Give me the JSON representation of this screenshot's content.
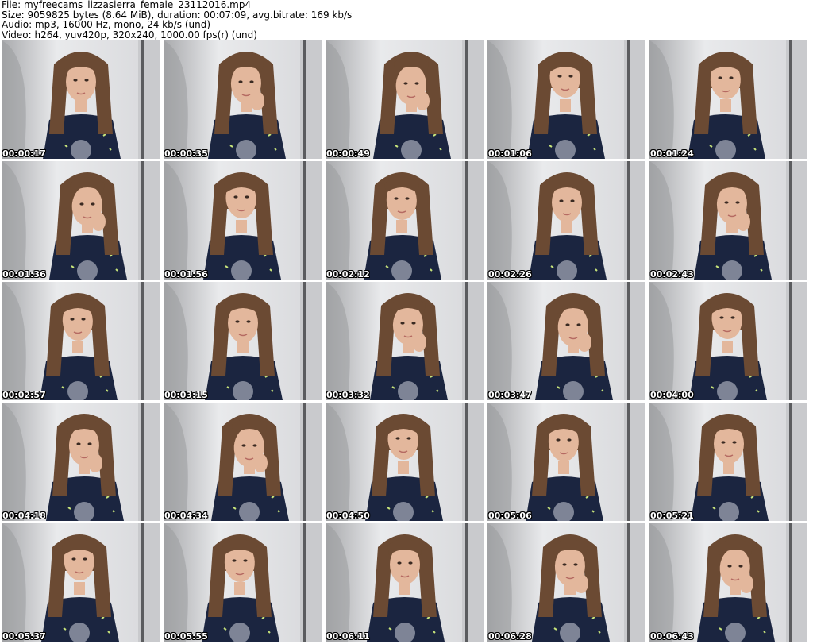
{
  "header": {
    "file": "File: myfreecams_lizzasierra_female_23112016.mp4",
    "size": "Size: 9059825 bytes (8.64 MiB), duration: 00:07:09, avg.bitrate: 169 kb/s",
    "audio": "Audio: mp3, 16000 Hz, mono, 24 kb/s (und)",
    "video": "Video: h264, yuv420p, 320x240, 1000.00 fps(r) (und)"
  },
  "colors": {
    "wall_light": "#e9eaec",
    "wall_shadow": "#a9aaad",
    "hair": "#6b4a33",
    "sweater": "#1b2540",
    "skin": "#e3b79c"
  },
  "thumbnails": [
    {
      "timestamp": "00:00:17"
    },
    {
      "timestamp": "00:00:35"
    },
    {
      "timestamp": "00:00:49"
    },
    {
      "timestamp": "00:01:06"
    },
    {
      "timestamp": "00:01:24"
    },
    {
      "timestamp": "00:01:36"
    },
    {
      "timestamp": "00:01:56"
    },
    {
      "timestamp": "00:02:12"
    },
    {
      "timestamp": "00:02:26"
    },
    {
      "timestamp": "00:02:43"
    },
    {
      "timestamp": "00:02:57"
    },
    {
      "timestamp": "00:03:15"
    },
    {
      "timestamp": "00:03:32"
    },
    {
      "timestamp": "00:03:47"
    },
    {
      "timestamp": "00:04:00"
    },
    {
      "timestamp": "00:04:18"
    },
    {
      "timestamp": "00:04:34"
    },
    {
      "timestamp": "00:04:50"
    },
    {
      "timestamp": "00:05:06"
    },
    {
      "timestamp": "00:05:21"
    },
    {
      "timestamp": "00:05:37"
    },
    {
      "timestamp": "00:05:55"
    },
    {
      "timestamp": "00:06:11"
    },
    {
      "timestamp": "00:06:28"
    },
    {
      "timestamp": "00:06:43"
    }
  ]
}
